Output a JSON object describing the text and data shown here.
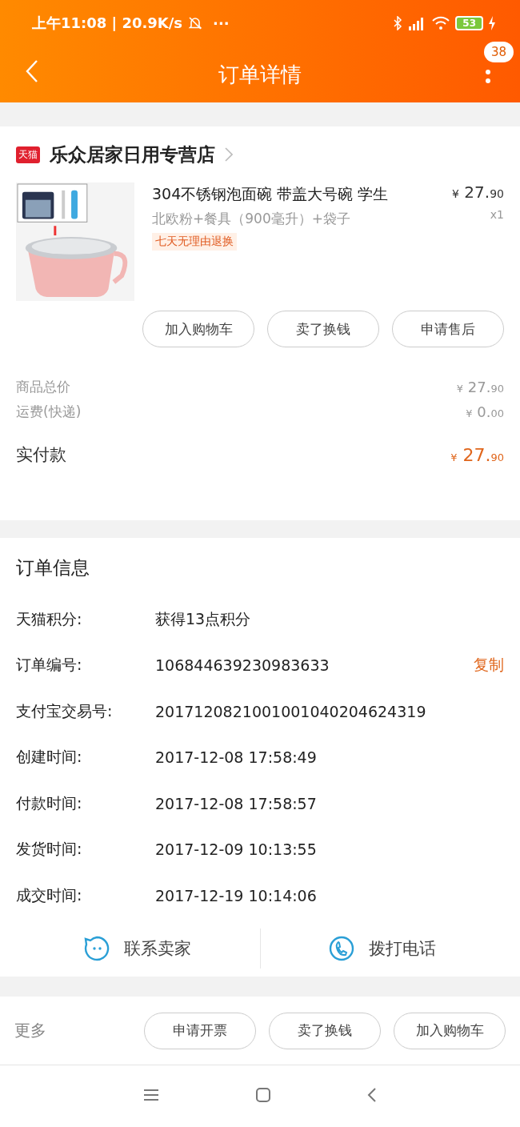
{
  "status_bar": {
    "time": "上午11:08 | 20.9K/s",
    "more": "···",
    "battery": "53"
  },
  "header": {
    "title": "订单详情",
    "badge": "38"
  },
  "store": {
    "name": "乐众居家日用专营店",
    "badge": "天猫"
  },
  "item": {
    "title": "304不锈钢泡面碗 带盖大号碗  学生",
    "sku": "北欧粉+餐具（900毫升）+袋子",
    "tag": "七天无理由退换",
    "currency": "¥",
    "price_int": "27.",
    "price_dec": "90",
    "qty": "x1",
    "actions": [
      "加入购物车",
      "卖了换钱",
      "申请售后"
    ]
  },
  "summary": [
    {
      "kind": "normal",
      "label": "商品总价",
      "currency": "¥",
      "int": "27.",
      "dec": "90"
    },
    {
      "kind": "normal",
      "label": "运费(快递)",
      "currency": "¥",
      "int": "0.",
      "dec": "00"
    },
    {
      "kind": "total",
      "label": "实付款",
      "currency": "¥",
      "int": "27.",
      "dec": "90"
    }
  ],
  "order_info": {
    "title": "订单信息",
    "rows": [
      {
        "label": "天猫积分:",
        "value": "获得13点积分"
      },
      {
        "label": "订单编号:",
        "value": "106844639230983633",
        "action": "复制"
      },
      {
        "label": "支付宝交易号:",
        "value": "2017120821001001040204624319"
      },
      {
        "label": "创建时间:",
        "value": "2017-12-08 17:58:49"
      },
      {
        "label": "付款时间:",
        "value": "2017-12-08 17:58:57"
      },
      {
        "label": "发货时间:",
        "value": "2017-12-09 10:13:55"
      },
      {
        "label": "成交时间:",
        "value": "2017-12-19 10:14:06"
      }
    ],
    "contacts": [
      {
        "kind": "chat",
        "label": "联系卖家"
      },
      {
        "kind": "phone",
        "label": "拨打电话"
      }
    ]
  },
  "more": {
    "label": "更多",
    "actions": [
      "申请开票",
      "卖了换钱",
      "加入购物车"
    ]
  }
}
